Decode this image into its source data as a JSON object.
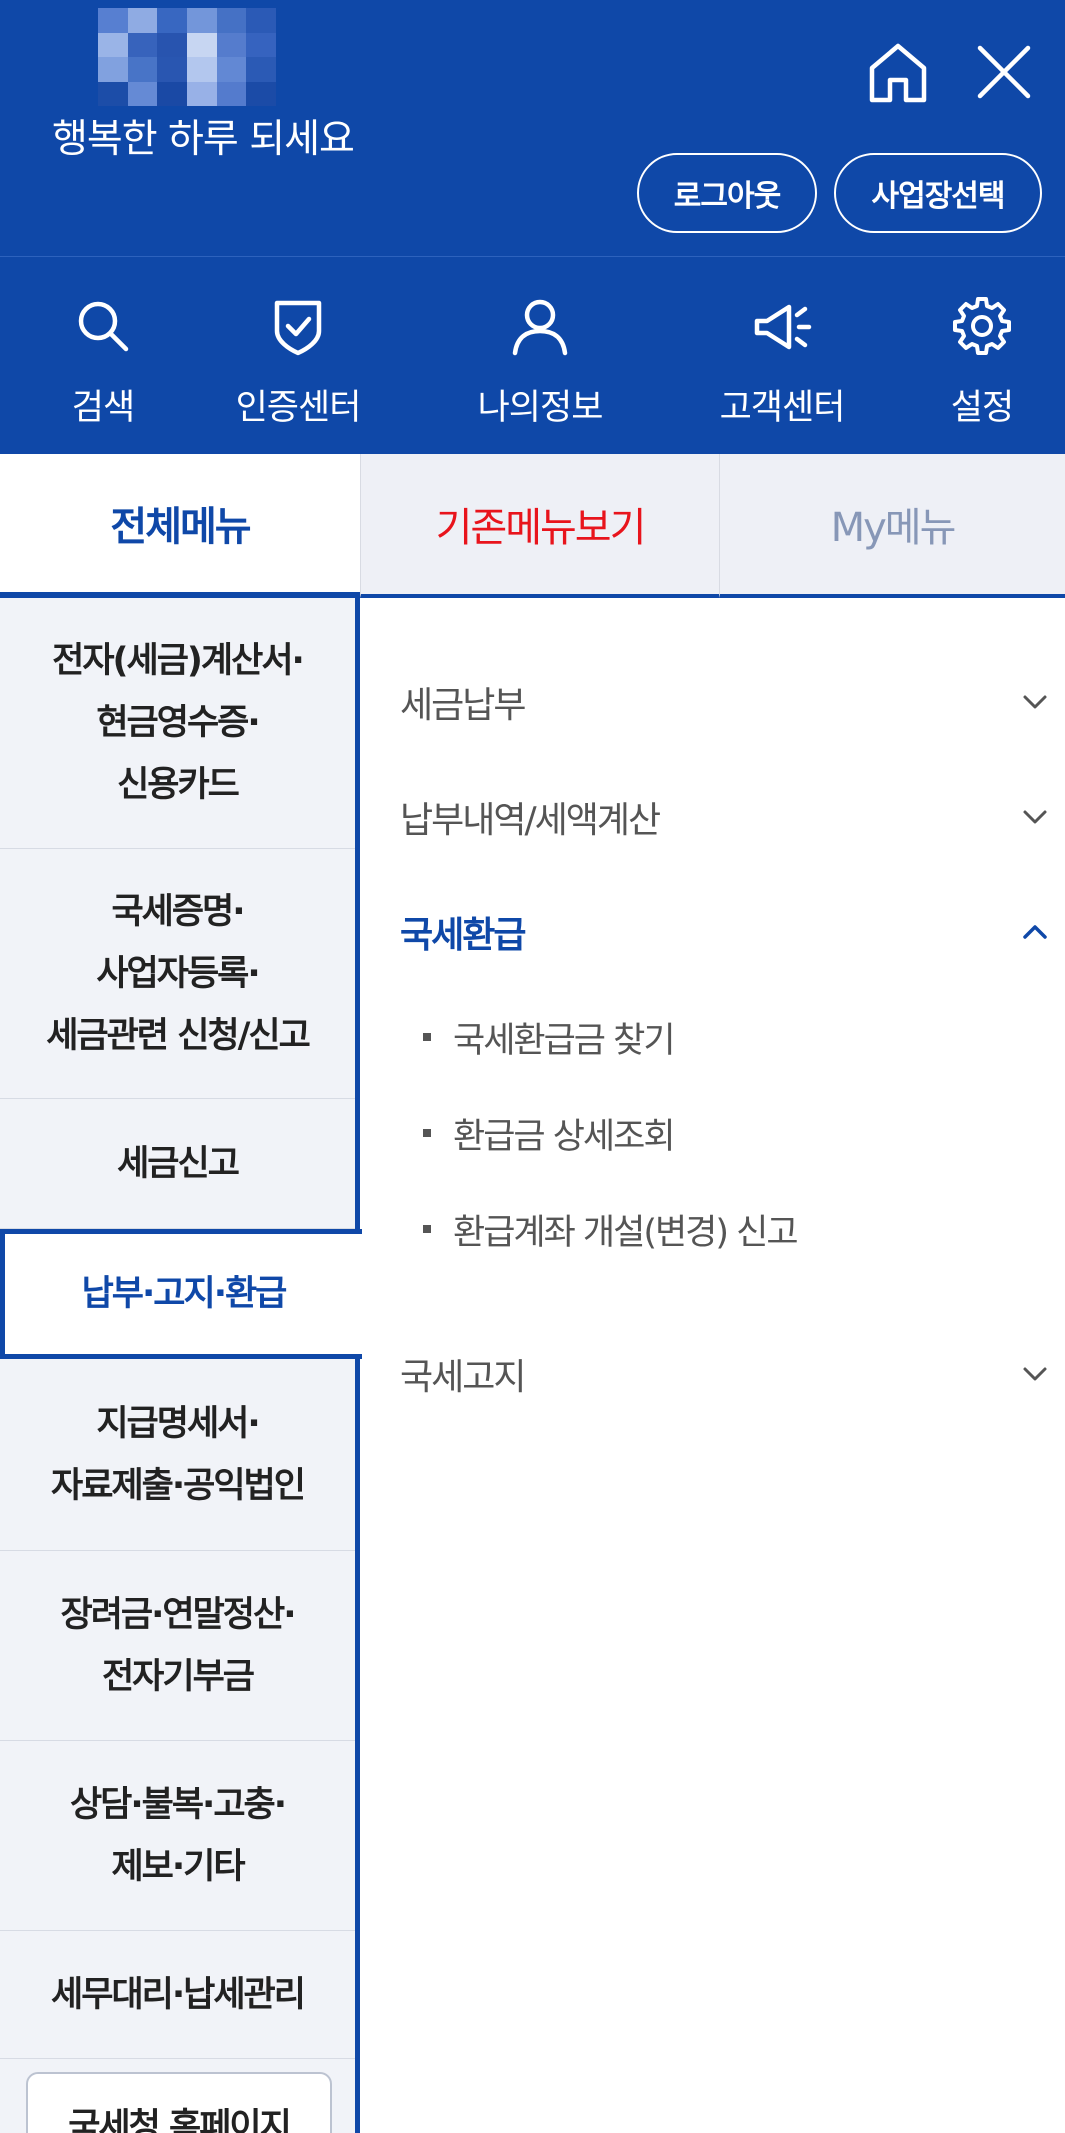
{
  "header": {
    "greeting": "행복한 하루 되세요",
    "logout_label": "로그아웃",
    "business_select_label": "사업장선택",
    "icons": {
      "home": "home-icon",
      "close": "close-icon"
    }
  },
  "quick_nav": [
    {
      "label": "검색",
      "icon": "search-icon"
    },
    {
      "label": "인증센터",
      "icon": "shield-check-icon"
    },
    {
      "label": "나의정보",
      "icon": "user-icon"
    },
    {
      "label": "고객센터",
      "icon": "megaphone-icon"
    },
    {
      "label": "설정",
      "icon": "gear-icon"
    }
  ],
  "tabs": [
    {
      "label": "전체메뉴",
      "active": true
    },
    {
      "label": "기존메뉴보기",
      "active": false
    },
    {
      "label": "My메뉴",
      "active": false
    }
  ],
  "left_menu": [
    {
      "line1": "전자(세금)계산서·",
      "line2": "현금영수증·",
      "line3": "신용카드"
    },
    {
      "line1": "국세증명·",
      "line2": "사업자등록·",
      "line3": "세금관련 신청/신고"
    },
    {
      "line1": "세금신고"
    },
    {
      "line1": "납부·고지·환급",
      "active": true
    },
    {
      "line1": "지급명세서·",
      "line2": "자료제출·공익법인"
    },
    {
      "line1": "장려금·연말정산·",
      "line2": "전자기부금"
    },
    {
      "line1": "상담·불복·고충·",
      "line2": "제보·기타"
    },
    {
      "line1": "세무대리·납세관리"
    }
  ],
  "home_link_label": "국세청 홈페이지",
  "submenu": {
    "sections": [
      {
        "label": "세금납부",
        "expanded": false
      },
      {
        "label": "납부내역/세액계산",
        "expanded": false
      },
      {
        "label": "국세환급",
        "expanded": true,
        "items": [
          "국세환급금 찾기",
          "환급금 상세조회",
          "환급계좌 개설(변경) 신고"
        ]
      },
      {
        "label": "국세고지",
        "expanded": false
      }
    ]
  },
  "colors": {
    "brand": "#0f48a8",
    "alert": "#e8141c",
    "muted": "#8797b7"
  }
}
